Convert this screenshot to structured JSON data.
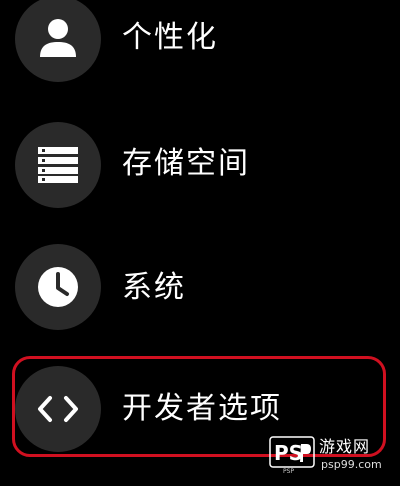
{
  "menu": {
    "items": [
      {
        "label": "个性化",
        "icon": "person-icon"
      },
      {
        "label": "存储空间",
        "icon": "storage-icon"
      },
      {
        "label": "系统",
        "icon": "clock-icon"
      },
      {
        "label": "开发者选项",
        "icon": "code-icon"
      }
    ]
  },
  "highlight": {
    "color": "#d01020"
  },
  "watermark": {
    "logo_text": "PSP",
    "site_name": "游戏网",
    "url": "psp99.com"
  },
  "colors": {
    "background": "#000000",
    "icon_circle": "#2a2a2a",
    "text": "#ffffff"
  }
}
